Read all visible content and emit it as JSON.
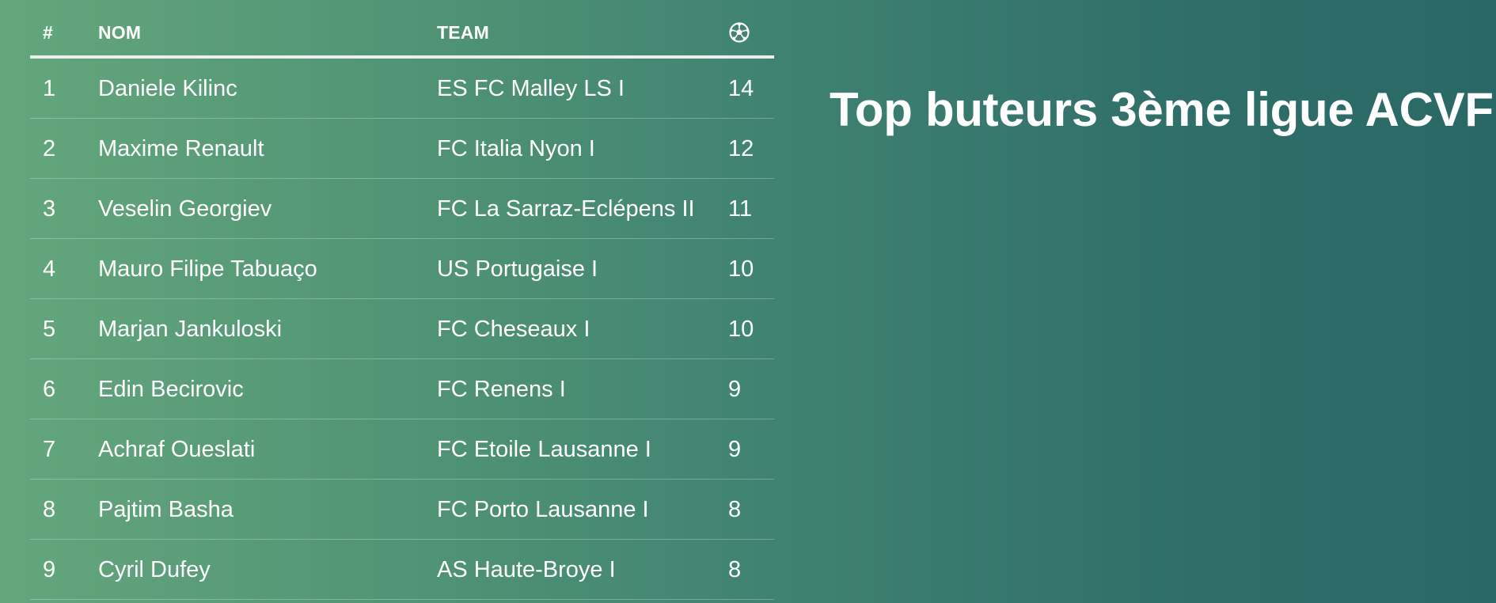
{
  "title": "Top buteurs 3ème ligue ACVF",
  "table": {
    "headers": {
      "rank": "#",
      "name": "NOM",
      "team": "TEAM",
      "goals_icon": "soccer-ball-icon"
    },
    "rows": [
      {
        "rank": "1",
        "name": "Daniele Kilinc",
        "team": "ES FC Malley LS I",
        "goals": "14"
      },
      {
        "rank": "2",
        "name": "Maxime Renault",
        "team": "FC Italia Nyon I",
        "goals": "12"
      },
      {
        "rank": "3",
        "name": "Veselin Georgiev",
        "team": "FC La Sarraz-Eclépens II",
        "goals": "11"
      },
      {
        "rank": "4",
        "name": "Mauro Filipe Tabuaço",
        "team": "US Portugaise I",
        "goals": "10"
      },
      {
        "rank": "5",
        "name": "Marjan Jankuloski",
        "team": "FC Cheseaux I",
        "goals": "10"
      },
      {
        "rank": "6",
        "name": "Edin Becirovic",
        "team": "FC Renens I",
        "goals": "9"
      },
      {
        "rank": "7",
        "name": "Achraf Oueslati",
        "team": "FC Etoile Lausanne I",
        "goals": "9"
      },
      {
        "rank": "8",
        "name": "Pajtim Basha",
        "team": "FC Porto Lausanne I",
        "goals": "8"
      },
      {
        "rank": "9",
        "name": "Cyril Dufey",
        "team": "AS Haute-Broye I",
        "goals": "8"
      }
    ]
  },
  "colors": {
    "background_left": "#64a67c",
    "background_right": "#2a6866",
    "text": "#ffffff"
  }
}
